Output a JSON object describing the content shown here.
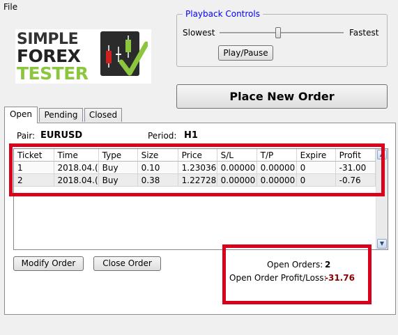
{
  "menu": {
    "file_label": "File"
  },
  "logo": {
    "line1": "SIMPLE",
    "line2": "FOREX",
    "line3": "TESTER"
  },
  "playback": {
    "title": "Playback Controls",
    "slowest_label": "Slowest",
    "fastest_label": "Fastest",
    "speed_fraction": 0.47,
    "play_pause_label": "Play/Pause"
  },
  "place_order_label": "Place New Order",
  "tabs": [
    {
      "label": "Open"
    },
    {
      "label": "Pending"
    },
    {
      "label": "Closed"
    }
  ],
  "active_tab": "Open",
  "info": {
    "pair_label": "Pair:",
    "pair_value": "EURUSD",
    "period_label": "Period:",
    "period_value": "H1"
  },
  "orders_table": {
    "columns": [
      "Ticket",
      "Time",
      "Type",
      "Size",
      "Price",
      "S/L",
      "T/P",
      "Expire",
      "Profit"
    ],
    "rows": [
      [
        "1",
        "2018.04.(",
        "Buy",
        "0.10",
        "1.23036",
        "0.00000",
        "0.00000",
        "0",
        "-31.00"
      ],
      [
        "2",
        "2018.04.(",
        "Buy",
        "0.38",
        "1.22728",
        "0.00000",
        "0.00000",
        "0",
        "-0.76"
      ]
    ]
  },
  "buttons": {
    "modify_label": "Modify Order",
    "close_label": "Close Order"
  },
  "summary": {
    "open_orders_label": "Open Orders:",
    "open_orders_value": "2",
    "profit_loss_label": "Open Order Profit/Loss:",
    "profit_loss_value": "-31.76"
  },
  "colors": {
    "annotation_red": "#d9001b",
    "title_blue": "#0000ff",
    "loss_red": "#8b0000",
    "logo_green": "#8cc63f"
  }
}
